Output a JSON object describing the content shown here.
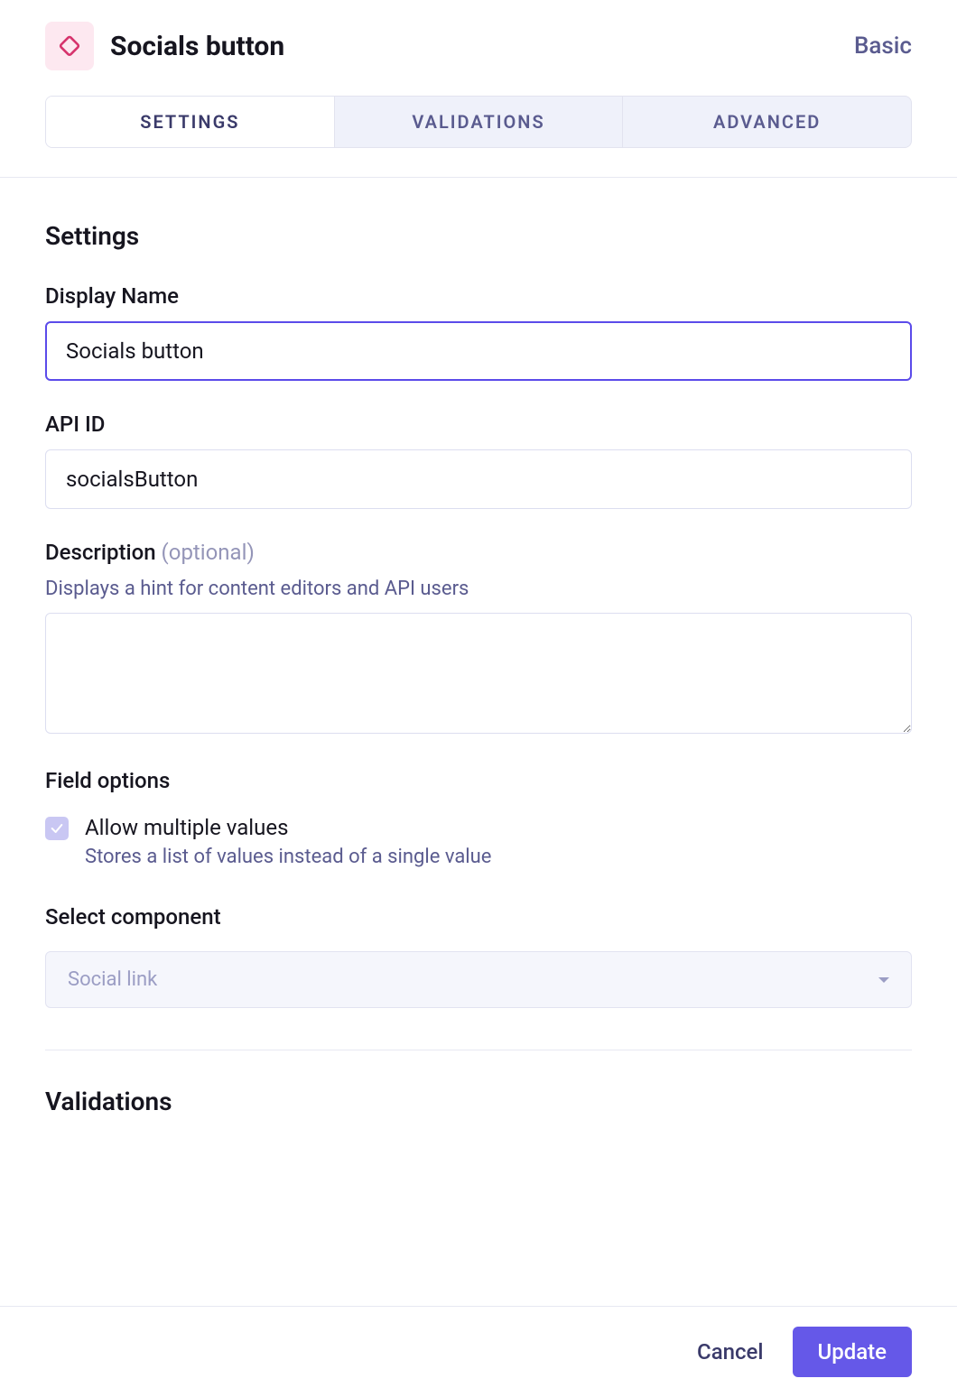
{
  "header": {
    "title": "Socials button",
    "type_label": "Basic",
    "icon_name": "component-icon"
  },
  "tabs": [
    {
      "label": "Settings",
      "active": true
    },
    {
      "label": "Validations",
      "active": false
    },
    {
      "label": "Advanced",
      "active": false
    }
  ],
  "settings": {
    "section_title": "Settings",
    "display_name": {
      "label": "Display Name",
      "value": "Socials button"
    },
    "api_id": {
      "label": "API ID",
      "value": "socialsButton"
    },
    "description": {
      "label": "Description",
      "optional_text": "(optional)",
      "hint": "Displays a hint for content editors and API users",
      "value": ""
    },
    "field_options": {
      "title": "Field options",
      "allow_multiple": {
        "label": "Allow multiple values",
        "description": "Stores a list of values instead of a single value",
        "checked": true
      }
    },
    "select_component": {
      "label": "Select component",
      "value": "Social link"
    }
  },
  "validations": {
    "section_title": "Validations"
  },
  "footer": {
    "cancel": "Cancel",
    "update": "Update"
  },
  "colors": {
    "accent": "#6558e8",
    "icon_bg": "#fde8f0",
    "icon_stroke": "#d6336c",
    "muted_text": "#5a5b8f"
  }
}
